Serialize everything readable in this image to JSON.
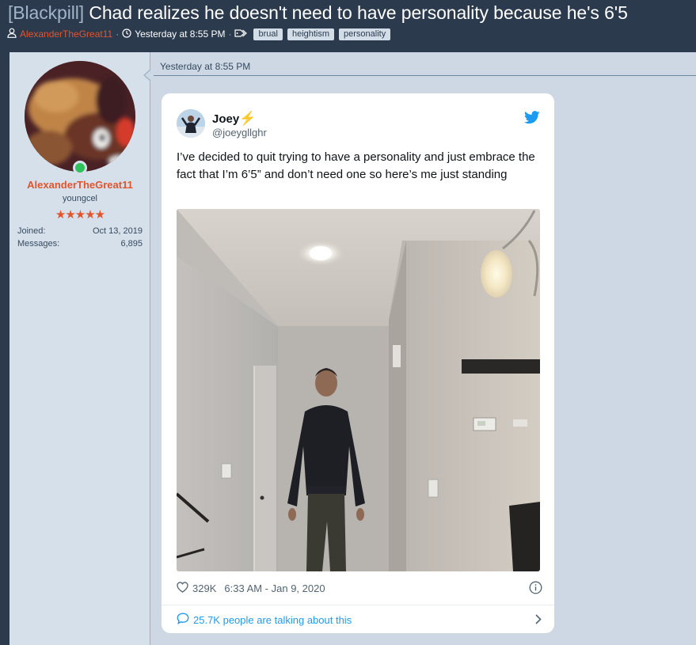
{
  "thread": {
    "prefix": "[Blackpill]",
    "title": "Chad realizes he doesn't need to have personality because he's 6'5",
    "author": "AlexanderTheGreat11",
    "time": "Yesterday at 8:55 PM",
    "sep": "·",
    "tags": [
      "brual",
      "heightism",
      "personality"
    ]
  },
  "user": {
    "name": "AlexanderTheGreat11",
    "title": "youngcel",
    "stars": "★★★★★",
    "joined_label": "Joined:",
    "joined_value": "Oct 13, 2019",
    "messages_label": "Messages:",
    "messages_value": "6,895"
  },
  "post": {
    "date": "Yesterday at 8:55 PM"
  },
  "tweet": {
    "name": "Joey",
    "bolt": "⚡",
    "handle": "@joeygllghr",
    "text": "I’ve decided to quit trying to have a personality and just embrace the fact that I’m 6’5” and don’t need one so here’s me just standing",
    "likes": "329K",
    "timestamp": "6:33 AM - Jan 9, 2020",
    "conversation": "25.7K people are talking about this"
  },
  "colors": {
    "accent": "#e2542c",
    "twitter_blue": "#1d9bf0",
    "header_bg": "#2b3a4d",
    "post_bg": "#cdd8e4"
  },
  "icons": [
    "user-icon",
    "clock-icon",
    "tag-icon",
    "twitter-bird-icon",
    "heart-icon",
    "info-icon",
    "speech-bubble-icon",
    "chevron-right-icon"
  ]
}
